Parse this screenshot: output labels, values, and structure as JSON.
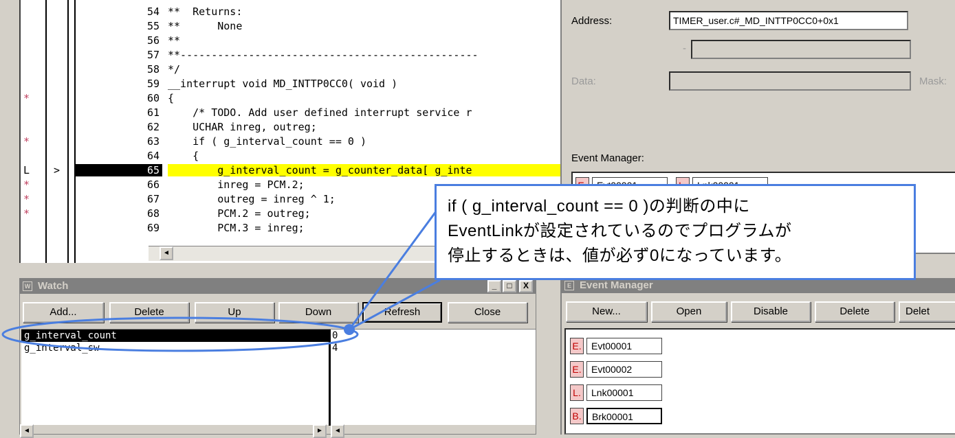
{
  "source": {
    "lines": [
      {
        "no": "54",
        "text": "**  Returns:",
        "mark": "",
        "arrow": ""
      },
      {
        "no": "55",
        "text": "**      None",
        "mark": "",
        "arrow": ""
      },
      {
        "no": "56",
        "text": "**",
        "mark": "",
        "arrow": ""
      },
      {
        "no": "57",
        "text": "**------------------------------------------------",
        "mark": "",
        "arrow": ""
      },
      {
        "no": "58",
        "text": "*/",
        "mark": "",
        "arrow": ""
      },
      {
        "no": "59",
        "text": "__interrupt void MD_INTTP0CC0( void )",
        "mark": "",
        "arrow": ""
      },
      {
        "no": "60",
        "text": "{",
        "mark": "*",
        "arrow": ""
      },
      {
        "no": "61",
        "text": "    /* TODO. Add user defined interrupt service r",
        "mark": "",
        "arrow": ""
      },
      {
        "no": "62",
        "text": "    UCHAR inreg, outreg;",
        "mark": "",
        "arrow": ""
      },
      {
        "no": "63",
        "text": "    if ( g_interval_count == 0 )",
        "mark": "*",
        "arrow": ""
      },
      {
        "no": "64",
        "text": "    {",
        "mark": "",
        "arrow": ""
      },
      {
        "no": "65",
        "text": "        g_interval_count = g_counter_data[ g_inte",
        "mark": "L",
        "arrow": ">"
      },
      {
        "no": "66",
        "text": "        inreg = PCM.2;",
        "mark": "*",
        "arrow": ""
      },
      {
        "no": "67",
        "text": "        outreg = inreg ^ 1;",
        "mark": "*",
        "arrow": ""
      },
      {
        "no": "68",
        "text": "        PCM.2 = outreg;",
        "mark": "*",
        "arrow": ""
      },
      {
        "no": "69",
        "text": "        PCM.3 = inreg;",
        "mark": "",
        "arrow": ""
      }
    ],
    "current_line": "65",
    "scroll_left": "◄"
  },
  "event_detail": {
    "address_label": "Address:",
    "address_value": "TIMER_user.c#_MD_INTTP0CC0+0x1",
    "range_sep": "-",
    "data_label": "Data:",
    "mask_label": "Mask:",
    "event_manager_label": "Event Manager:"
  },
  "watch": {
    "title": "Watch",
    "buttons": [
      "Add...",
      "Delete",
      "Up",
      "Down",
      "Refresh",
      "Close"
    ],
    "rows": [
      {
        "name": "g_interval_count",
        "value": "0"
      },
      {
        "name": "g_interval_sw",
        "value": "4"
      }
    ],
    "minimize": "_",
    "maximize": "□",
    "close": "X"
  },
  "event_manager": {
    "title": "Event Manager",
    "buttons": [
      "New...",
      "Open",
      "Disable",
      "Delete",
      "Delet"
    ],
    "items": [
      {
        "badge": "E.",
        "name": "Evt00001"
      },
      {
        "badge": "E.",
        "name": "Evt00002"
      },
      {
        "badge": "L.",
        "name": "Lnk00001"
      },
      {
        "badge": "B.",
        "name": "Brk00001"
      }
    ],
    "preview_items": [
      {
        "badge": "E.",
        "name": "Evt00001"
      },
      {
        "badge": "L.",
        "name": "Lnk00001"
      }
    ]
  },
  "callout": {
    "line1": "if ( g_interval_count == 0 )の判断の中に",
    "line2": "EventLinkが設定されているのでプログラムが",
    "line3": "停止するときは、値が必ず0になっています。"
  },
  "colors": {
    "callout_border": "#4a7ee0",
    "highlight": "#ffff00"
  }
}
